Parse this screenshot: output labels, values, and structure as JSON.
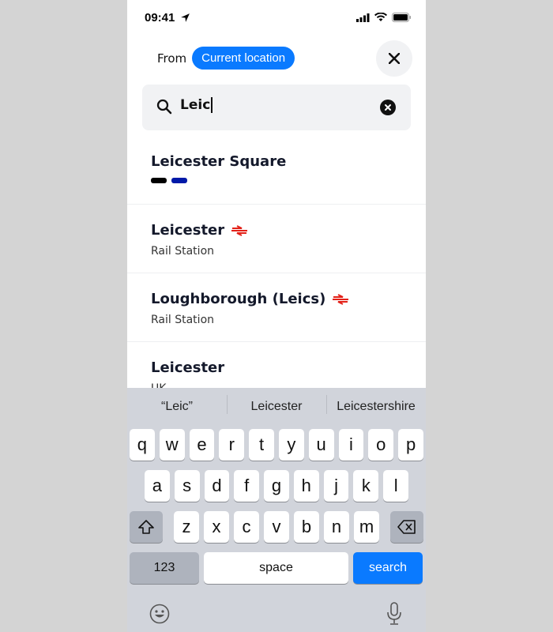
{
  "status_bar": {
    "time": "09:41"
  },
  "header": {
    "from_label": "From",
    "origin_chip": "Current location"
  },
  "search": {
    "value": "Leic",
    "placeholder": ""
  },
  "results": [
    {
      "title": "Leicester Square",
      "subtitle": "",
      "rail_icon": false,
      "lines": [
        {
          "name": "Northern",
          "color": "#000000"
        },
        {
          "name": "Piccadilly",
          "color": "#0019a8"
        }
      ]
    },
    {
      "title": "Leicester",
      "subtitle": "Rail Station",
      "rail_icon": true,
      "lines": []
    },
    {
      "title": "Loughborough (Leics)",
      "subtitle": "Rail Station",
      "rail_icon": true,
      "lines": []
    },
    {
      "title": "Leicester",
      "subtitle": "UK",
      "rail_icon": false,
      "lines": []
    }
  ],
  "keyboard": {
    "predictions": [
      "“Leic”",
      "Leicester",
      "Leicestershire"
    ],
    "row1": [
      "q",
      "w",
      "e",
      "r",
      "t",
      "y",
      "u",
      "i",
      "o",
      "p"
    ],
    "row2": [
      "a",
      "s",
      "d",
      "f",
      "g",
      "h",
      "j",
      "k",
      "l"
    ],
    "row3": [
      "z",
      "x",
      "c",
      "v",
      "b",
      "n",
      "m"
    ],
    "numbers_label": "123",
    "space_label": "space",
    "action_label": "search"
  },
  "colors": {
    "accent": "#0a7aff",
    "rail": "#e32017"
  }
}
